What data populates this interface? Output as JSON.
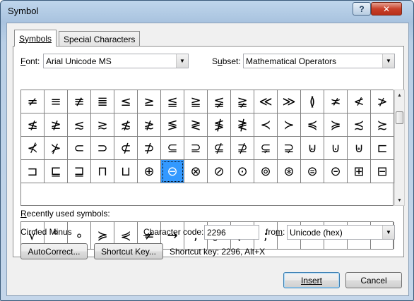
{
  "window": {
    "title": "Symbol",
    "help_glyph": "?",
    "close_glyph": "✕"
  },
  "tabs": [
    {
      "label": "Symbols",
      "active": true
    },
    {
      "label": "Special Characters",
      "active": false
    }
  ],
  "font": {
    "label_prefix": "F",
    "label_rest": "ont:",
    "value": "Arial Unicode MS"
  },
  "subset": {
    "label_prefix": "S",
    "label_u": "u",
    "label_rest": "bset:",
    "value": "Mathematical Operators"
  },
  "symbols": [
    "≠",
    "≡",
    "≢",
    "≣",
    "≤",
    "≥",
    "≦",
    "≧",
    "≨",
    "≩",
    "≪",
    "≫",
    "≬",
    "≭",
    "≮",
    "≯",
    "≰",
    "≱",
    "≲",
    "≳",
    "≴",
    "≵",
    "≶",
    "≷",
    "≸",
    "≹",
    "≺",
    "≻",
    "≼",
    "≽",
    "≾",
    "≿",
    "⊀",
    "⊁",
    "⊂",
    "⊃",
    "⊄",
    "⊅",
    "⊆",
    "⊇",
    "⊈",
    "⊉",
    "⊊",
    "⊋",
    "⊌",
    "⊍",
    "⊎",
    "⊏",
    "⊐",
    "⊑",
    "⊒",
    "⊓",
    "⊔",
    "⊕",
    "⊖",
    "⊗",
    "⊘",
    "⊙",
    "⊚",
    "⊛",
    "⊜",
    "⊝",
    "⊞",
    "⊟"
  ],
  "selected_index": 54,
  "recent": {
    "label_prefix": "R",
    "label_rest": "ecently used symbols:",
    "items": [
      "√",
      "°",
      "∘",
      "≽",
      "⋞",
      "≠",
      "→",
      ",",
      "。",
      "、",
      ";",
      ":",
      "!",
      "?",
      "“",
      "”"
    ]
  },
  "char_name": "Circled Minus",
  "char_code": {
    "label_prefix": "C",
    "label_rest": "haracter code:",
    "value": "2296"
  },
  "from": {
    "label_prefix": "fro",
    "label_u": "m",
    "label_rest": ":",
    "value": "Unicode (hex)"
  },
  "buttons": {
    "autocorrect": "AutoCorrect...",
    "shortcut_key": "Shortcut Key...",
    "insert": "Insert",
    "cancel": "Cancel"
  },
  "shortcut_text": "Shortcut key: 2296, Alt+X"
}
